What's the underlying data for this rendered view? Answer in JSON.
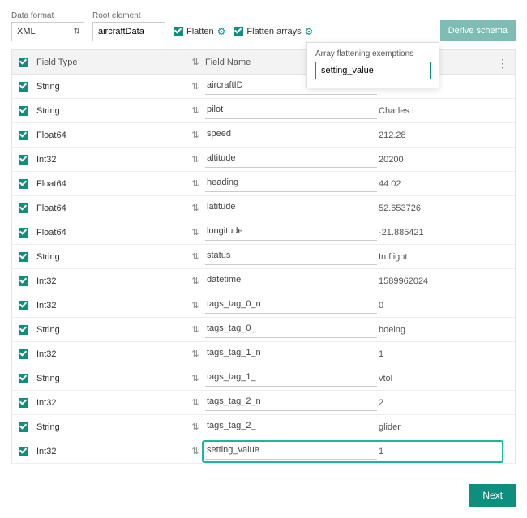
{
  "labels": {
    "data_format": "Data format",
    "root_element": "Root element",
    "flatten": "Flatten",
    "flatten_arrays": "Flatten arrays",
    "derive_schema": "Derive schema",
    "next": "Next",
    "field_type": "Field Type",
    "field_name": "Field Name",
    "popover_title": "Array flattening exemptions"
  },
  "values": {
    "data_format": "XML",
    "root_element": "aircraftData",
    "exemption": "setting_value"
  },
  "rows": [
    {
      "type": "String",
      "name": "aircraftID",
      "value": ""
    },
    {
      "type": "String",
      "name": "pilot",
      "value": "Charles L."
    },
    {
      "type": "Float64",
      "name": "speed",
      "value": "212.28"
    },
    {
      "type": "Int32",
      "name": "altitude",
      "value": "20200"
    },
    {
      "type": "Float64",
      "name": "heading",
      "value": "44.02"
    },
    {
      "type": "Float64",
      "name": "latitude",
      "value": "52.653726"
    },
    {
      "type": "Float64",
      "name": "longitude",
      "value": "-21.885421"
    },
    {
      "type": "String",
      "name": "status",
      "value": "In flight"
    },
    {
      "type": "Int32",
      "name": "datetime",
      "value": "1589962024"
    },
    {
      "type": "Int32",
      "name": "tags_tag_0_n",
      "value": "0"
    },
    {
      "type": "String",
      "name": "tags_tag_0_",
      "value": "boeing"
    },
    {
      "type": "Int32",
      "name": "tags_tag_1_n",
      "value": "1"
    },
    {
      "type": "String",
      "name": "tags_tag_1_",
      "value": "vtol"
    },
    {
      "type": "Int32",
      "name": "tags_tag_2_n",
      "value": "2"
    },
    {
      "type": "String",
      "name": "tags_tag_2_",
      "value": "glider"
    },
    {
      "type": "Int32",
      "name": "setting_value",
      "value": "1"
    }
  ]
}
